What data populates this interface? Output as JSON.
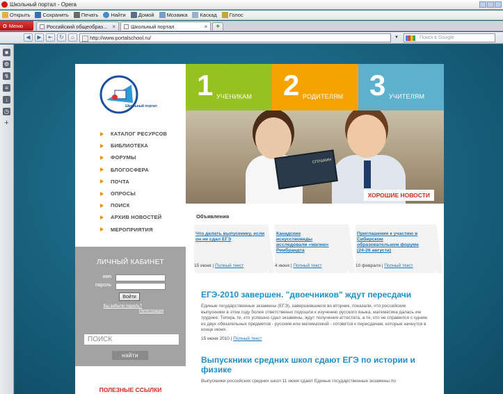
{
  "window": {
    "title": "Школьный портал - Opera"
  },
  "toolbar": {
    "items": [
      "Открыть",
      "Сохранить",
      "Печать",
      "Найти",
      "Домой",
      "Мозаика",
      "Каскад",
      "Голос"
    ]
  },
  "tabs": {
    "menu_label": "Меню",
    "items": [
      {
        "label": "Российский общеобраз..."
      },
      {
        "label": "Школьный портал"
      }
    ],
    "new_tab": "+"
  },
  "address": {
    "url": "http://www.portalschool.ru/",
    "search_placeholder": "Поиск в Google"
  },
  "site": {
    "logo_text": "Школьный портал",
    "menu": [
      "КАТАЛОГ РЕСУРСОВ",
      "БИБЛИОТЕКА",
      "ФОРУМЫ",
      "БЛОГОСФЕРА",
      "ПОЧТА",
      "ОПРОСЫ",
      "ПОИСК",
      "АРХИВ НОВОСТЕЙ",
      "МЕРОПРИЯТИЯ"
    ],
    "sections": [
      {
        "num": "1",
        "label": "УЧЕНИКАМ",
        "color": "#96c11f"
      },
      {
        "num": "2",
        "label": "РОДИТЕЛЯМ",
        "color": "#f6a300"
      },
      {
        "num": "3",
        "label": "УЧИТЕЛЯМ",
        "color": "#5eb1cc"
      }
    ],
    "book_title": "СПУШКИН",
    "good_news": "ХОРОШИЕ НОВОСТИ",
    "cabinet": {
      "title": "ЛИЧНЫЙ КАБИНЕТ",
      "login_label": "имя",
      "password_label": "пароль",
      "login_button": "Войти",
      "forgot_link": "Вы забыли пароль?",
      "register_link": "Регистрация"
    },
    "search": {
      "placeholder": "ПОИСК",
      "button": "найти"
    },
    "useful_links": "ПОЛЕЗНЫЕ ССЫЛКИ",
    "announcements": {
      "title": "Объявления",
      "items": [
        {
          "title": "Что делать выпускнику, если он не сдал ЕГЭ",
          "date": "15 июня",
          "more": "Полный текст"
        },
        {
          "title": "Канадские искусствоведы исследовали «магию» Рембрандта",
          "date": "4 июня",
          "more": "Полный текст"
        },
        {
          "title": "Приглашение к участию в Сибирском образовательном форуме (24-26 августа)",
          "date": "10 февраля",
          "more": "Полный текст"
        }
      ]
    },
    "news": [
      {
        "title": "ЕГЭ-2010 завершен. \"двоечников\" ждут пересдачи",
        "text": "Единые государственные экзамены (ЕГЭ), завершившиеся во вторник, показали, что российские выпускники в этом году более ответственно подошли к изучению русского языка, математика далась им труднее. Теперь те, кто успешно сдал экзамены, ждут получения аттестата, а те, кто не справился с одним из двух обязательных предметов - русским или математикой - готовятся к пересдачам, которые начнутся в конце июня.",
        "date": "15 июня 2010",
        "more": "Полный текст"
      },
      {
        "title": "Выпускники средних школ сдают ЕГЭ по истории и физике",
        "text": "Выпускники российских средних школ 11 июня сдают Единые государственные экзамены по",
        "date": "",
        "more": ""
      }
    ]
  }
}
